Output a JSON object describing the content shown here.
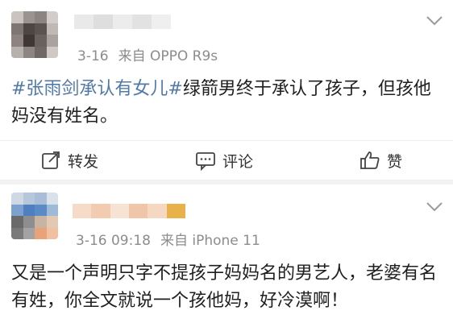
{
  "post1": {
    "time": "3-16",
    "source": "来自 OPPO R9s",
    "hashtag": "#张雨剑承认有女儿#",
    "text": "绿箭男终于承认了孩子，但孩他妈没有姓名。"
  },
  "actions": {
    "repost": "转发",
    "comment": "评论",
    "like": "赞"
  },
  "post2": {
    "time": "3-16 09:18",
    "source": "来自 iPhone 11",
    "text": "又是一个声明只字不提孩子妈妈名的男艺人，老婆有名有姓，你全文就说一个孩他妈，好冷漠啊！"
  },
  "colors": {
    "hashtag": "#5279a8",
    "meta": "#8c8c8c"
  }
}
